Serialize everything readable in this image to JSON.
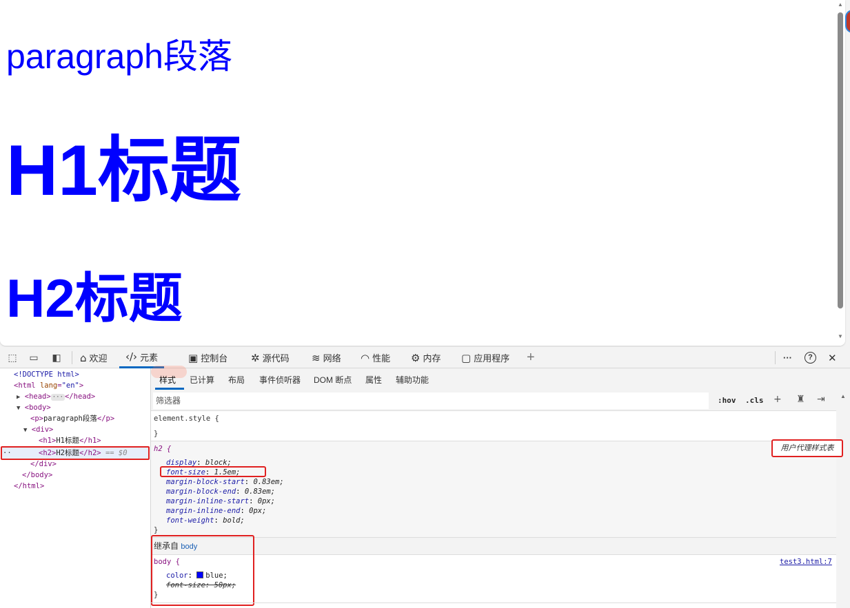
{
  "viewport": {
    "paragraph": "paragraph段落",
    "h1": "H1标题",
    "h2": "H2标题"
  },
  "devtools": {
    "tabs": [
      {
        "label": "欢迎",
        "icon": "home-icon"
      },
      {
        "label": "元素",
        "icon": "code-icon"
      },
      {
        "label": "控制台",
        "icon": "console-icon"
      },
      {
        "label": "源代码",
        "icon": "bug-icon"
      },
      {
        "label": "网络",
        "icon": "wifi-icon"
      },
      {
        "label": "性能",
        "icon": "gauge-icon"
      },
      {
        "label": "内存",
        "icon": "chip-icon"
      },
      {
        "label": "应用程序",
        "icon": "app-icon"
      }
    ],
    "add_tab": "+",
    "more": "···",
    "help": "?",
    "close": "✕",
    "active_tab": "元素"
  },
  "dom_tree": {
    "doctype": "<!DOCTYPE html>",
    "html_open": "html",
    "html_attr": "lang",
    "html_attr_val": "\"en\"",
    "head": "head",
    "body": "body",
    "p": "p",
    "p_text": "paragraph段落",
    "div": "div",
    "h1": "h1",
    "h1_text": "H1标题",
    "h2": "h2",
    "h2_text": "H2标题",
    "selected_marker": "== $0",
    "ellipsis": "···",
    "row_dots": "··"
  },
  "styles_pane": {
    "subtabs": [
      "样式",
      "已计算",
      "布局",
      "事件侦听器",
      "DOM 断点",
      "属性",
      "辅助功能"
    ],
    "filter_placeholder": "筛选器",
    "hov": ":hov",
    "cls": ".cls",
    "element_style": "element.style {",
    "close_brace": "}",
    "ua_selector": "h2 {",
    "ua_label": "用户代理样式表",
    "ua_props": [
      {
        "name": "display",
        "value": "block;"
      },
      {
        "name": "font-size",
        "value": "1.5em;"
      },
      {
        "name": "margin-block-start",
        "value": "0.83em;"
      },
      {
        "name": "margin-block-end",
        "value": "0.83em;"
      },
      {
        "name": "margin-inline-start",
        "value": "0px;"
      },
      {
        "name": "margin-inline-end",
        "value": "0px;"
      },
      {
        "name": "font-weight",
        "value": "bold;"
      }
    ],
    "inherited_label": "继承自",
    "inherited_from": "body",
    "body_selector": "body {",
    "body_source": "test3.html:7",
    "body_color_prop": "color",
    "body_color_val": "blue;",
    "body_fontsize_struck": "font-size: 50px;"
  },
  "colors": {
    "content_text": "#0000ff",
    "highlight_border": "#e02020",
    "active_tab_accent": "#0067c0"
  }
}
